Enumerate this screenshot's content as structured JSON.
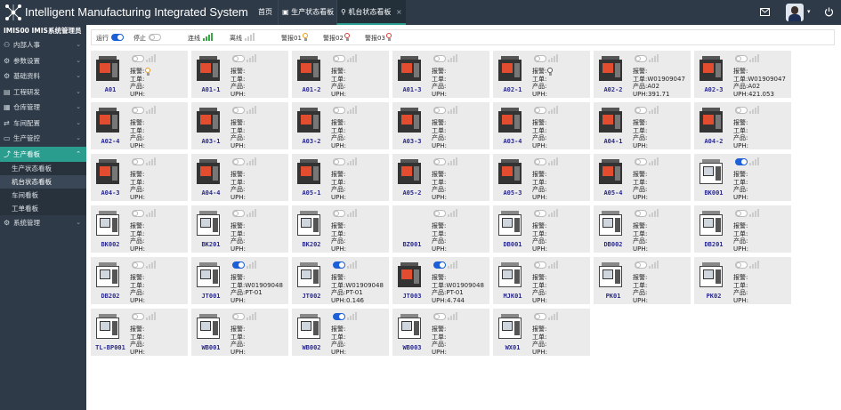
{
  "app": {
    "title": "Intelligent Manufacturing Integrated System"
  },
  "nav": {
    "home": "首页",
    "tabs": [
      {
        "label": "生产状态看板"
      },
      {
        "label": "机台状态看板"
      }
    ]
  },
  "sidebar": {
    "user": "IMIS00 IMIS系统管理员",
    "items": [
      {
        "label": "内部人事"
      },
      {
        "label": "参数设置"
      },
      {
        "label": "基础资料"
      },
      {
        "label": "工程研发"
      },
      {
        "label": "仓库管理"
      },
      {
        "label": "车间配置"
      },
      {
        "label": "生产管控"
      },
      {
        "label": "生产看板"
      },
      {
        "label": "系统管理"
      }
    ],
    "subitems": [
      {
        "label": "生产状态看板"
      },
      {
        "label": "机台状态看板"
      },
      {
        "label": "车间看板"
      },
      {
        "label": "工单看板"
      }
    ]
  },
  "legend": {
    "run": "运行",
    "stop": "停止",
    "online": "连线",
    "offline": "离线",
    "alarm1": "警报01",
    "alarm2": "警报02",
    "alarm3": "警报03"
  },
  "labels": {
    "alarm": "报警:",
    "order": "工单:",
    "product": "产品:",
    "uph": "UPH:"
  },
  "colors": {
    "accent": "#2a9d8f",
    "toggle_on": "#1d5fd6",
    "signal_on": "#3aa846",
    "alarm1": "#e89b1a",
    "alarm2": "#d83b3b",
    "machine_name": "#2a2a8f"
  },
  "machines": [
    {
      "name": "A01",
      "type": "red",
      "running": false,
      "alarm": "alarm1",
      "order": "",
      "product": "",
      "uph": ""
    },
    {
      "name": "A01-1",
      "type": "red",
      "running": false,
      "alarm": "",
      "order": "",
      "product": "",
      "uph": ""
    },
    {
      "name": "A01-2",
      "type": "red",
      "running": false,
      "alarm": "",
      "order": "",
      "product": "",
      "uph": ""
    },
    {
      "name": "A01-3",
      "type": "red",
      "running": false,
      "alarm": "",
      "order": "",
      "product": "",
      "uph": ""
    },
    {
      "name": "A02-1",
      "type": "red",
      "running": false,
      "alarm": "alarm3",
      "order": "",
      "product": "",
      "uph": ""
    },
    {
      "name": "A02-2",
      "type": "red",
      "running": false,
      "alarm": "",
      "order": "W01909047",
      "product": "A02",
      "uph": "391.71"
    },
    {
      "name": "A02-3",
      "type": "red",
      "running": false,
      "alarm": "",
      "order": "W01909047",
      "product": "A02",
      "uph": "421.053"
    },
    {
      "name": "A02-4",
      "type": "red",
      "running": false,
      "alarm": "",
      "order": "",
      "product": "",
      "uph": ""
    },
    {
      "name": "A03-1",
      "type": "red",
      "running": false,
      "alarm": "",
      "order": "",
      "product": "",
      "uph": ""
    },
    {
      "name": "A03-2",
      "type": "red",
      "running": false,
      "alarm": "",
      "order": "",
      "product": "",
      "uph": ""
    },
    {
      "name": "A03-3",
      "type": "red",
      "running": false,
      "alarm": "",
      "order": "",
      "product": "",
      "uph": ""
    },
    {
      "name": "A03-4",
      "type": "red",
      "running": false,
      "alarm": "",
      "order": "",
      "product": "",
      "uph": ""
    },
    {
      "name": "A04-1",
      "type": "red",
      "running": false,
      "alarm": "",
      "order": "",
      "product": "",
      "uph": ""
    },
    {
      "name": "A04-2",
      "type": "red",
      "running": false,
      "alarm": "",
      "order": "",
      "product": "",
      "uph": ""
    },
    {
      "name": "A04-3",
      "type": "red",
      "running": false,
      "alarm": "",
      "order": "",
      "product": "",
      "uph": ""
    },
    {
      "name": "A04-4",
      "type": "red",
      "running": false,
      "alarm": "",
      "order": "",
      "product": "",
      "uph": ""
    },
    {
      "name": "A05-1",
      "type": "red",
      "running": false,
      "alarm": "",
      "order": "",
      "product": "",
      "uph": ""
    },
    {
      "name": "A05-2",
      "type": "red",
      "running": false,
      "alarm": "",
      "order": "",
      "product": "",
      "uph": ""
    },
    {
      "name": "A05-3",
      "type": "red",
      "running": false,
      "alarm": "",
      "order": "",
      "product": "",
      "uph": ""
    },
    {
      "name": "A05-4",
      "type": "red",
      "running": false,
      "alarm": "",
      "order": "",
      "product": "",
      "uph": ""
    },
    {
      "name": "BK001",
      "type": "white",
      "running": true,
      "alarm": "",
      "order": "",
      "product": "",
      "uph": ""
    },
    {
      "name": "BK002",
      "type": "white",
      "running": false,
      "alarm": "",
      "order": "",
      "product": "",
      "uph": ""
    },
    {
      "name": "BK201",
      "type": "white",
      "running": false,
      "alarm": "",
      "order": "",
      "product": "",
      "uph": ""
    },
    {
      "name": "BK202",
      "type": "white",
      "running": false,
      "alarm": "",
      "order": "",
      "product": "",
      "uph": ""
    },
    {
      "name": "BZ001",
      "type": "none",
      "running": false,
      "alarm": "",
      "order": "",
      "product": "",
      "uph": ""
    },
    {
      "name": "DB001",
      "type": "white",
      "running": false,
      "alarm": "",
      "order": "",
      "product": "",
      "uph": ""
    },
    {
      "name": "DB002",
      "type": "white",
      "running": false,
      "alarm": "",
      "order": "",
      "product": "",
      "uph": ""
    },
    {
      "name": "DB201",
      "type": "white",
      "running": false,
      "alarm": "",
      "order": "",
      "product": "",
      "uph": ""
    },
    {
      "name": "DB202",
      "type": "white",
      "running": false,
      "alarm": "",
      "order": "",
      "product": "",
      "uph": ""
    },
    {
      "name": "JT001",
      "type": "white",
      "running": true,
      "alarm": "",
      "order": "W01909048",
      "product": "PT-01",
      "uph": ""
    },
    {
      "name": "JT002",
      "type": "white",
      "running": true,
      "alarm": "",
      "order": "W01909048",
      "product": "PT-01",
      "uph": "0.146"
    },
    {
      "name": "JT003",
      "type": "red",
      "running": true,
      "alarm": "",
      "order": "W01909048",
      "product": "PT-01",
      "uph": "4.744"
    },
    {
      "name": "MJK01",
      "type": "white",
      "running": false,
      "alarm": "",
      "order": "",
      "product": "",
      "uph": ""
    },
    {
      "name": "PK01",
      "type": "white",
      "running": false,
      "alarm": "",
      "order": "",
      "product": "",
      "uph": ""
    },
    {
      "name": "PK02",
      "type": "white",
      "running": false,
      "alarm": "",
      "order": "",
      "product": "",
      "uph": ""
    },
    {
      "name": "TL-BP001",
      "type": "white",
      "running": false,
      "alarm": "",
      "order": "",
      "product": "",
      "uph": ""
    },
    {
      "name": "WB001",
      "type": "white",
      "running": false,
      "alarm": "",
      "order": "",
      "product": "",
      "uph": ""
    },
    {
      "name": "WB002",
      "type": "white",
      "running": true,
      "alarm": "",
      "order": "",
      "product": "",
      "uph": ""
    },
    {
      "name": "WB003",
      "type": "white",
      "running": false,
      "alarm": "",
      "order": "",
      "product": "",
      "uph": ""
    },
    {
      "name": "WX01",
      "type": "white",
      "running": false,
      "alarm": "",
      "order": "",
      "product": "",
      "uph": ""
    }
  ]
}
